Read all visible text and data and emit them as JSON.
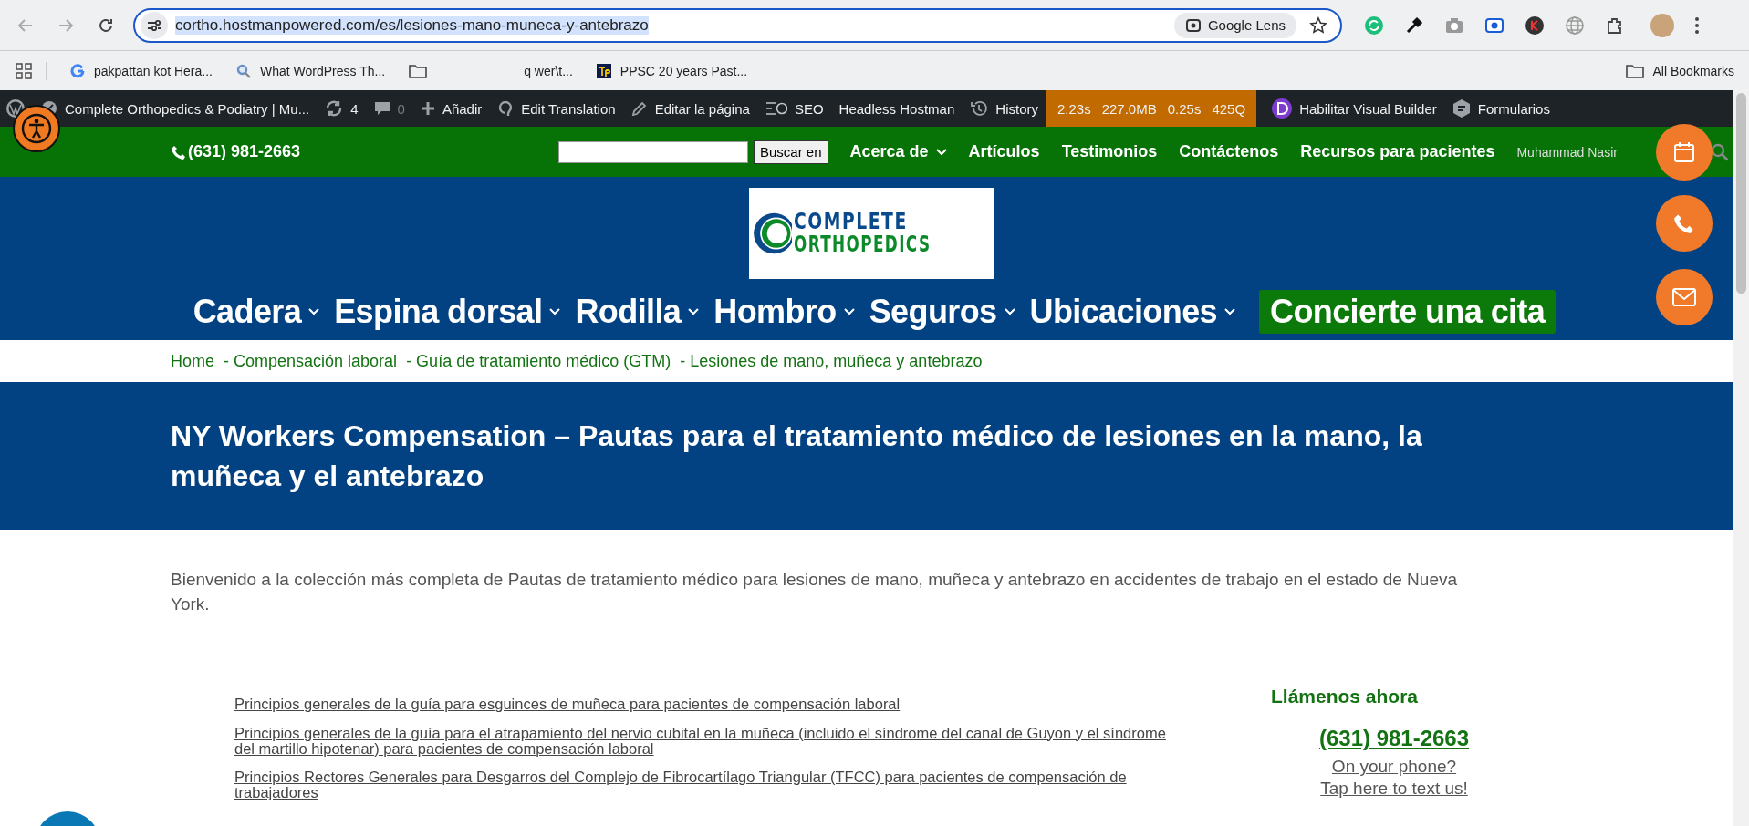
{
  "browser": {
    "url": "cortho.hostmanpowered.com/es/lesiones-mano-muneca-y-antebrazo",
    "lens_label": "Google Lens",
    "bookmarks": [
      {
        "kind": "apps"
      },
      {
        "kind": "google",
        "label": "pakpattan kot Hera..."
      },
      {
        "kind": "search",
        "label": "What WordPress Th..."
      },
      {
        "kind": "folder"
      },
      {
        "kind": "plain",
        "label": "q wer\\t..."
      },
      {
        "kind": "tp",
        "label": "PPSC 20 years Past..."
      }
    ],
    "all_bookmarks": "All Bookmarks"
  },
  "admin_bar": {
    "site_title": "Complete Orthopedics & Podiatry | Mu...",
    "updates": "4",
    "comments": "0",
    "items": [
      {
        "kind": "add",
        "label": "Añadir"
      },
      {
        "kind": "translate",
        "label": "Edit Translation"
      },
      {
        "kind": "edit",
        "label": "Editar la página"
      },
      {
        "kind": "seo",
        "label": "SEO"
      },
      {
        "kind": "plain",
        "label": "Headless Hostman"
      },
      {
        "kind": "history",
        "label": "History"
      }
    ],
    "perf": [
      "2.23s",
      "227.0MB",
      "0.25s",
      "425Q"
    ],
    "visual_builder": "Habilitar Visual Builder",
    "forms": "Formularios"
  },
  "topbar": {
    "phone": "(631) 981-2663",
    "search_button": "Buscar en",
    "menu": [
      {
        "label": "Acerca de",
        "dropdown": true
      },
      {
        "label": "Artículos",
        "dropdown": false
      },
      {
        "label": "Testimonios",
        "dropdown": false
      },
      {
        "label": "Contáctenos",
        "dropdown": false
      },
      {
        "label": "Recursos para pacientes",
        "dropdown": false
      }
    ],
    "greeting": "Muhammad Nasir"
  },
  "logo": {
    "line1": "COMPLETE",
    "line2": "ORTHOPEDICS"
  },
  "main_nav": [
    {
      "label": "Cadera",
      "dropdown": true
    },
    {
      "label": "Espina dorsal",
      "dropdown": true
    },
    {
      "label": "Rodilla",
      "dropdown": true
    },
    {
      "label": "Hombro",
      "dropdown": true
    },
    {
      "label": "Seguros",
      "dropdown": true
    },
    {
      "label": "Ubicaciones",
      "dropdown": true
    }
  ],
  "cta": "Concierte una cita",
  "breadcrumb": [
    "Home",
    "- Compensación laboral",
    "- Guía de tratamiento médico (GTM)",
    "- Lesiones de mano, muñeca y antebrazo"
  ],
  "title": "NY Workers Compensation – Pautas para el tratamiento médico de lesiones en la mano, la muñeca y el antebrazo",
  "intro": "Bienvenido a la colección más completa de Pautas de tratamiento médico para lesiones de mano, muñeca y antebrazo en accidentes de trabajo en el estado de Nueva York.",
  "guide_links": [
    "Principios generales de la guía para esguinces de muñeca para pacientes de compensación laboral",
    "Principios generales de la guía para el atrapamiento del nervio cubital en la muñeca (incluido el síndrome del canal de Guyon y el síndrome del martillo hipotenar) para pacientes de compensación laboral",
    "Principios Rectores Generales para Desgarros del Complejo de Fibrocartílago Triangular (TFCC) para pacientes de compensación de trabajadores"
  ],
  "sidebar": {
    "heading": "Llámenos ahora",
    "phone": "(631) 981-2663",
    "line1": "On your phone?",
    "line2": "Tap here to text us!"
  }
}
